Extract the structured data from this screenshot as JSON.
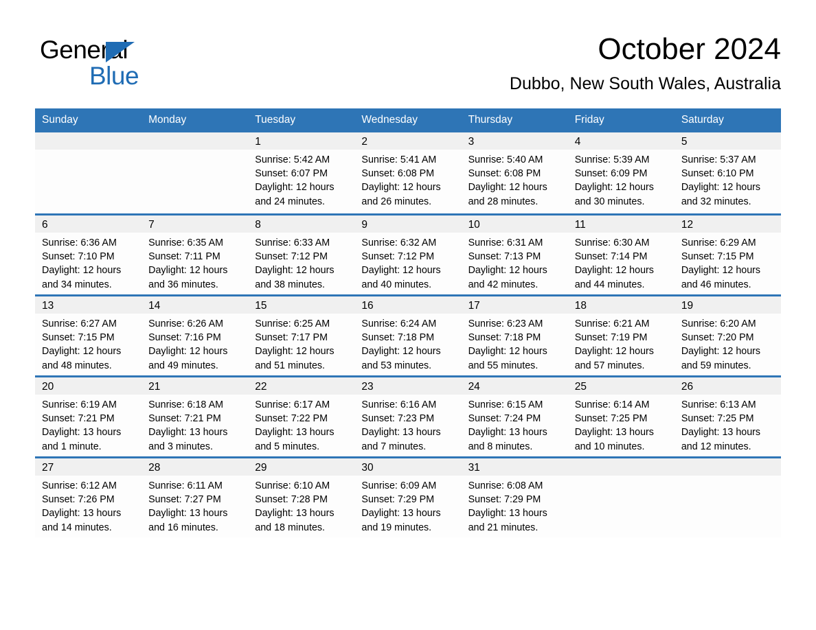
{
  "brand": {
    "name_part1": "General",
    "name_part2": "Blue",
    "triangle_icon": "brand-triangle-icon",
    "accent_color": "#1f6cb4"
  },
  "header": {
    "title": "October 2024",
    "subtitle": "Dubbo, New South Wales, Australia"
  },
  "colors": {
    "header_blue": "#2e75b6",
    "daystrip_gray": "#f0f0f0",
    "cell_white": "#fdfdfd",
    "text": "#000000"
  },
  "weekday_headers": [
    "Sunday",
    "Monday",
    "Tuesday",
    "Wednesday",
    "Thursday",
    "Friday",
    "Saturday"
  ],
  "weeks": [
    [
      {
        "day": "",
        "lines": []
      },
      {
        "day": "",
        "lines": []
      },
      {
        "day": "1",
        "lines": [
          "Sunrise: 5:42 AM",
          "Sunset: 6:07 PM",
          "Daylight: 12 hours",
          "and 24 minutes."
        ]
      },
      {
        "day": "2",
        "lines": [
          "Sunrise: 5:41 AM",
          "Sunset: 6:08 PM",
          "Daylight: 12 hours",
          "and 26 minutes."
        ]
      },
      {
        "day": "3",
        "lines": [
          "Sunrise: 5:40 AM",
          "Sunset: 6:08 PM",
          "Daylight: 12 hours",
          "and 28 minutes."
        ]
      },
      {
        "day": "4",
        "lines": [
          "Sunrise: 5:39 AM",
          "Sunset: 6:09 PM",
          "Daylight: 12 hours",
          "and 30 minutes."
        ]
      },
      {
        "day": "5",
        "lines": [
          "Sunrise: 5:37 AM",
          "Sunset: 6:10 PM",
          "Daylight: 12 hours",
          "and 32 minutes."
        ]
      }
    ],
    [
      {
        "day": "6",
        "lines": [
          "Sunrise: 6:36 AM",
          "Sunset: 7:10 PM",
          "Daylight: 12 hours",
          "and 34 minutes."
        ]
      },
      {
        "day": "7",
        "lines": [
          "Sunrise: 6:35 AM",
          "Sunset: 7:11 PM",
          "Daylight: 12 hours",
          "and 36 minutes."
        ]
      },
      {
        "day": "8",
        "lines": [
          "Sunrise: 6:33 AM",
          "Sunset: 7:12 PM",
          "Daylight: 12 hours",
          "and 38 minutes."
        ]
      },
      {
        "day": "9",
        "lines": [
          "Sunrise: 6:32 AM",
          "Sunset: 7:12 PM",
          "Daylight: 12 hours",
          "and 40 minutes."
        ]
      },
      {
        "day": "10",
        "lines": [
          "Sunrise: 6:31 AM",
          "Sunset: 7:13 PM",
          "Daylight: 12 hours",
          "and 42 minutes."
        ]
      },
      {
        "day": "11",
        "lines": [
          "Sunrise: 6:30 AM",
          "Sunset: 7:14 PM",
          "Daylight: 12 hours",
          "and 44 minutes."
        ]
      },
      {
        "day": "12",
        "lines": [
          "Sunrise: 6:29 AM",
          "Sunset: 7:15 PM",
          "Daylight: 12 hours",
          "and 46 minutes."
        ]
      }
    ],
    [
      {
        "day": "13",
        "lines": [
          "Sunrise: 6:27 AM",
          "Sunset: 7:15 PM",
          "Daylight: 12 hours",
          "and 48 minutes."
        ]
      },
      {
        "day": "14",
        "lines": [
          "Sunrise: 6:26 AM",
          "Sunset: 7:16 PM",
          "Daylight: 12 hours",
          "and 49 minutes."
        ]
      },
      {
        "day": "15",
        "lines": [
          "Sunrise: 6:25 AM",
          "Sunset: 7:17 PM",
          "Daylight: 12 hours",
          "and 51 minutes."
        ]
      },
      {
        "day": "16",
        "lines": [
          "Sunrise: 6:24 AM",
          "Sunset: 7:18 PM",
          "Daylight: 12 hours",
          "and 53 minutes."
        ]
      },
      {
        "day": "17",
        "lines": [
          "Sunrise: 6:23 AM",
          "Sunset: 7:18 PM",
          "Daylight: 12 hours",
          "and 55 minutes."
        ]
      },
      {
        "day": "18",
        "lines": [
          "Sunrise: 6:21 AM",
          "Sunset: 7:19 PM",
          "Daylight: 12 hours",
          "and 57 minutes."
        ]
      },
      {
        "day": "19",
        "lines": [
          "Sunrise: 6:20 AM",
          "Sunset: 7:20 PM",
          "Daylight: 12 hours",
          "and 59 minutes."
        ]
      }
    ],
    [
      {
        "day": "20",
        "lines": [
          "Sunrise: 6:19 AM",
          "Sunset: 7:21 PM",
          "Daylight: 13 hours",
          "and 1 minute."
        ]
      },
      {
        "day": "21",
        "lines": [
          "Sunrise: 6:18 AM",
          "Sunset: 7:21 PM",
          "Daylight: 13 hours",
          "and 3 minutes."
        ]
      },
      {
        "day": "22",
        "lines": [
          "Sunrise: 6:17 AM",
          "Sunset: 7:22 PM",
          "Daylight: 13 hours",
          "and 5 minutes."
        ]
      },
      {
        "day": "23",
        "lines": [
          "Sunrise: 6:16 AM",
          "Sunset: 7:23 PM",
          "Daylight: 13 hours",
          "and 7 minutes."
        ]
      },
      {
        "day": "24",
        "lines": [
          "Sunrise: 6:15 AM",
          "Sunset: 7:24 PM",
          "Daylight: 13 hours",
          "and 8 minutes."
        ]
      },
      {
        "day": "25",
        "lines": [
          "Sunrise: 6:14 AM",
          "Sunset: 7:25 PM",
          "Daylight: 13 hours",
          "and 10 minutes."
        ]
      },
      {
        "day": "26",
        "lines": [
          "Sunrise: 6:13 AM",
          "Sunset: 7:25 PM",
          "Daylight: 13 hours",
          "and 12 minutes."
        ]
      }
    ],
    [
      {
        "day": "27",
        "lines": [
          "Sunrise: 6:12 AM",
          "Sunset: 7:26 PM",
          "Daylight: 13 hours",
          "and 14 minutes."
        ]
      },
      {
        "day": "28",
        "lines": [
          "Sunrise: 6:11 AM",
          "Sunset: 7:27 PM",
          "Daylight: 13 hours",
          "and 16 minutes."
        ]
      },
      {
        "day": "29",
        "lines": [
          "Sunrise: 6:10 AM",
          "Sunset: 7:28 PM",
          "Daylight: 13 hours",
          "and 18 minutes."
        ]
      },
      {
        "day": "30",
        "lines": [
          "Sunrise: 6:09 AM",
          "Sunset: 7:29 PM",
          "Daylight: 13 hours",
          "and 19 minutes."
        ]
      },
      {
        "day": "31",
        "lines": [
          "Sunrise: 6:08 AM",
          "Sunset: 7:29 PM",
          "Daylight: 13 hours",
          "and 21 minutes."
        ]
      },
      {
        "day": "",
        "lines": []
      },
      {
        "day": "",
        "lines": []
      }
    ]
  ]
}
